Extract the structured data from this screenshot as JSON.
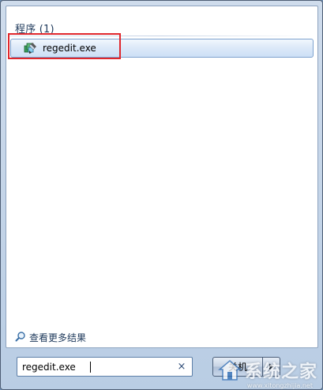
{
  "results": {
    "section_header": "程序 (1)",
    "items": [
      {
        "label": "regedit.exe",
        "icon": "regedit-icon"
      }
    ]
  },
  "more_results": {
    "label": "查看更多结果",
    "icon": "magnifier-icon"
  },
  "search": {
    "value": "regedit.exe",
    "clear_glyph": "×"
  },
  "power": {
    "button_label": "关机",
    "arrow_glyph": "▶"
  },
  "watermark": {
    "text": "系统之家",
    "subtext": "www.xitongzhijia.net"
  },
  "colors": {
    "highlight": "#e0272c",
    "selection_border": "#7da2ce",
    "header_text": "#1e395b"
  }
}
